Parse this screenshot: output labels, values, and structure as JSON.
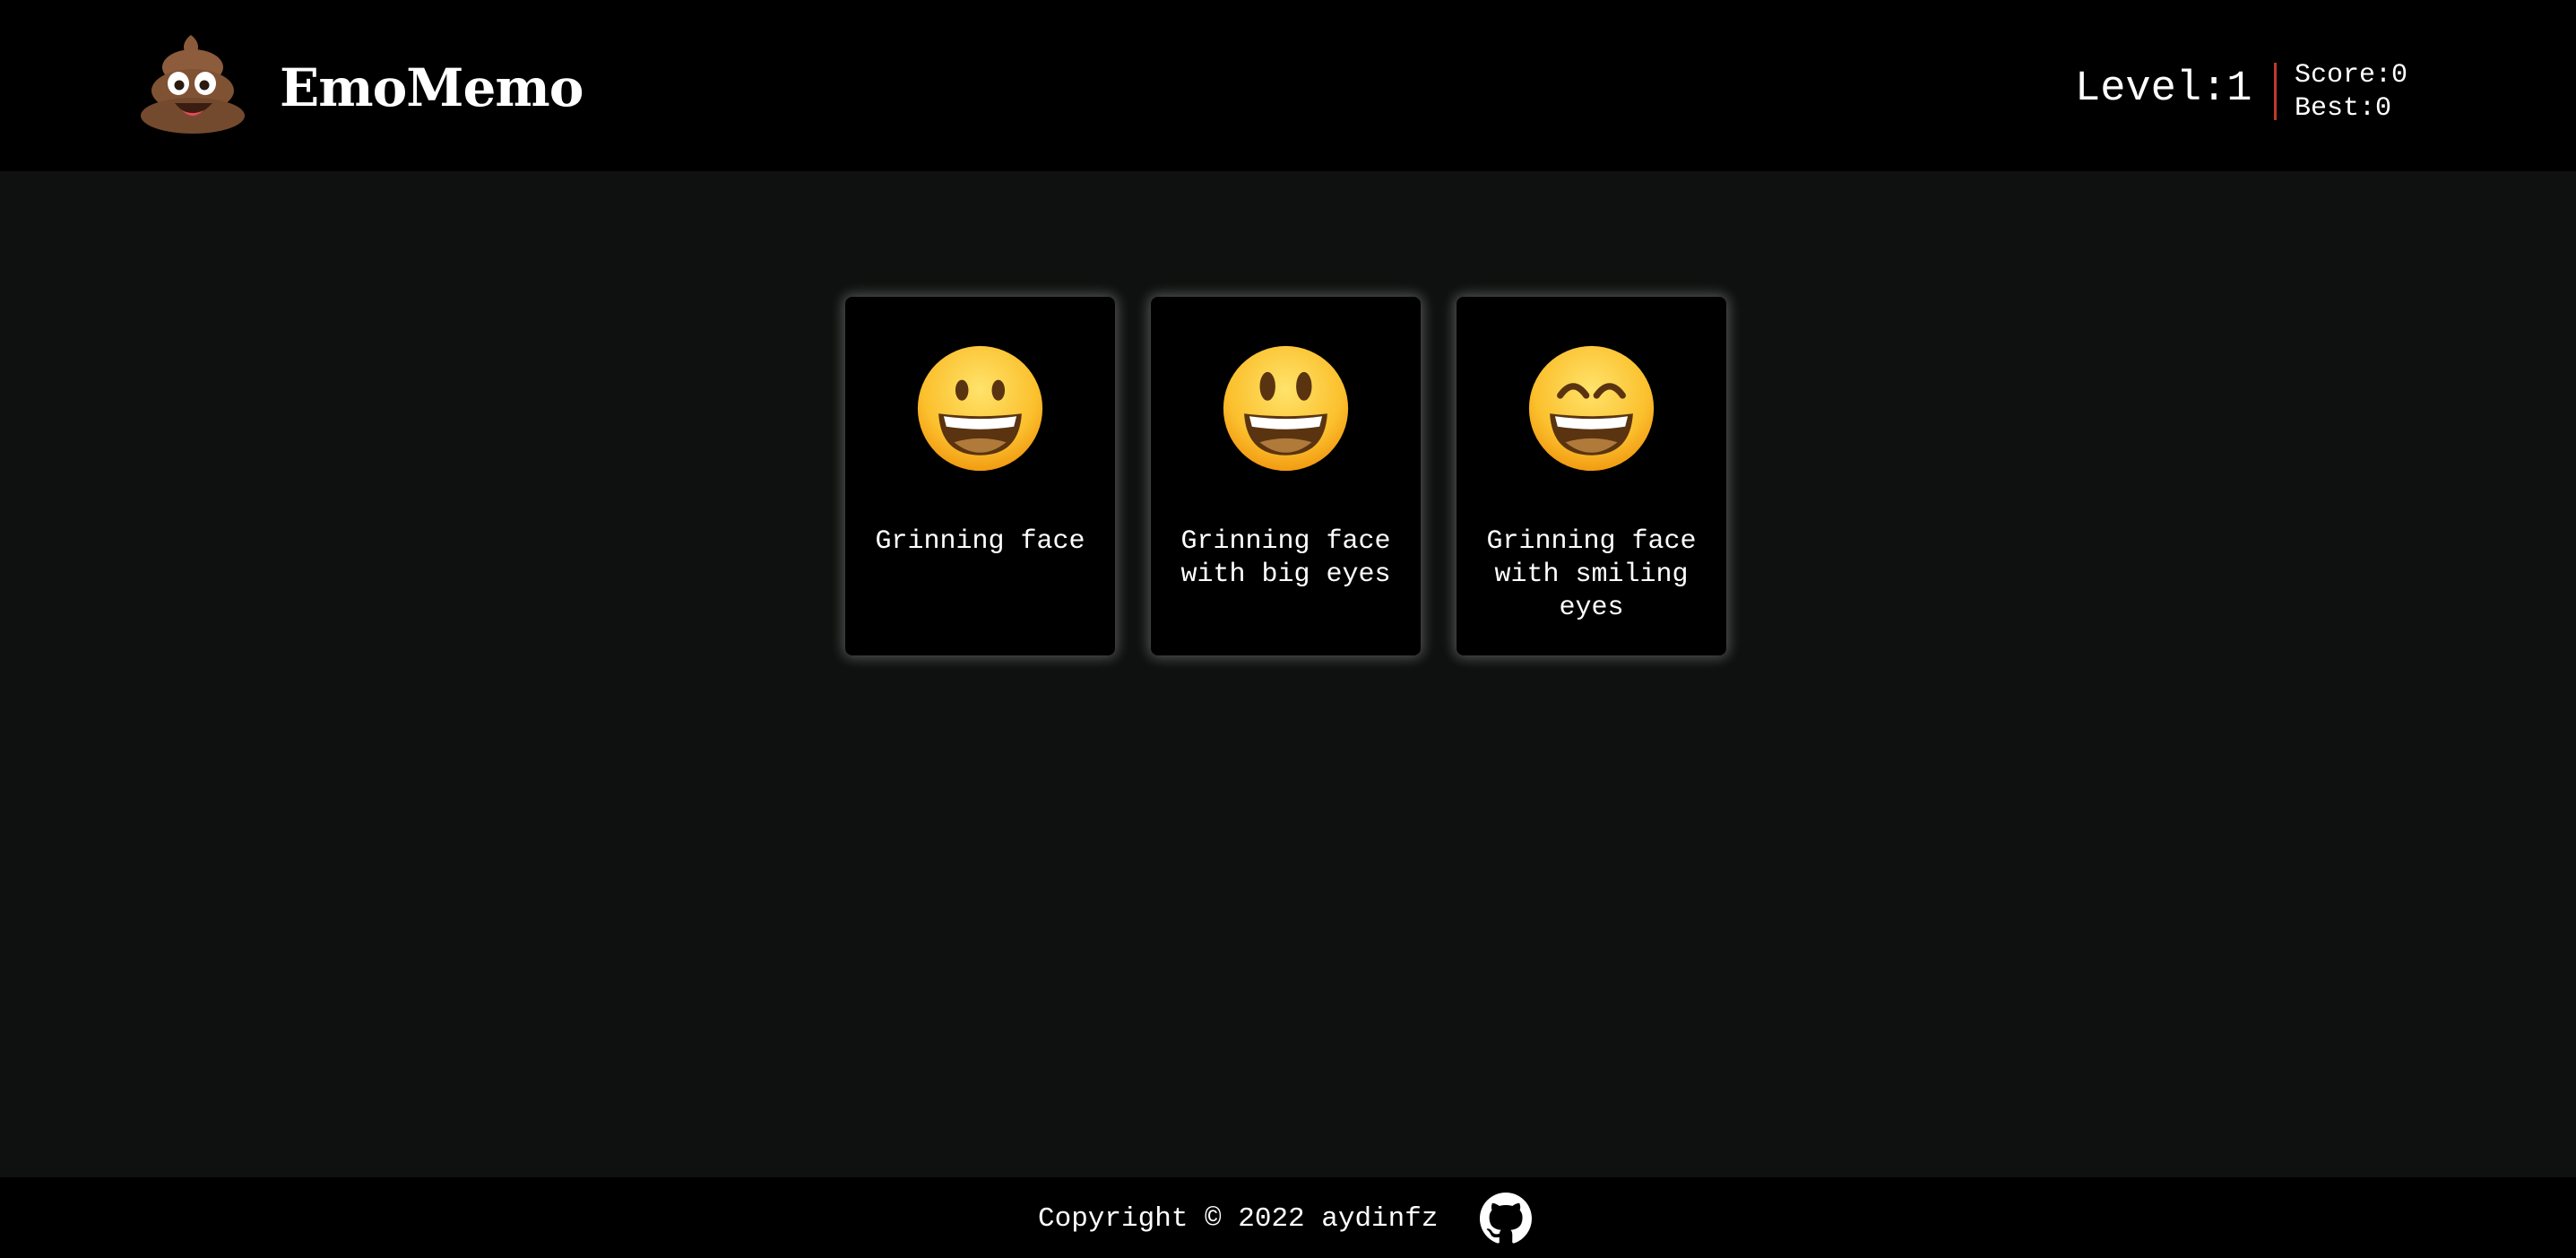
{
  "header": {
    "logo_icon": "pile-of-poo-icon",
    "title": "EmoMemo",
    "level_label": "Level:1",
    "score_label": "Score:0",
    "best_label": "Best:0",
    "divider_color": "#c0392b"
  },
  "cards": [
    {
      "icon": "grinning-face-icon",
      "label": "Grinning face"
    },
    {
      "icon": "grinning-face-with-big-eyes-icon",
      "label": "Grinning face with big eyes"
    },
    {
      "icon": "grinning-face-with-smiling-eyes-icon",
      "label": "Grinning face with smiling eyes"
    }
  ],
  "footer": {
    "copyright": "Copyright © 2022 aydinfz",
    "github_icon": "github-icon"
  },
  "colors": {
    "header_bg": "#000000",
    "page_bg": "#0f1110",
    "card_bg": "#000000",
    "text": "#ffffff"
  }
}
